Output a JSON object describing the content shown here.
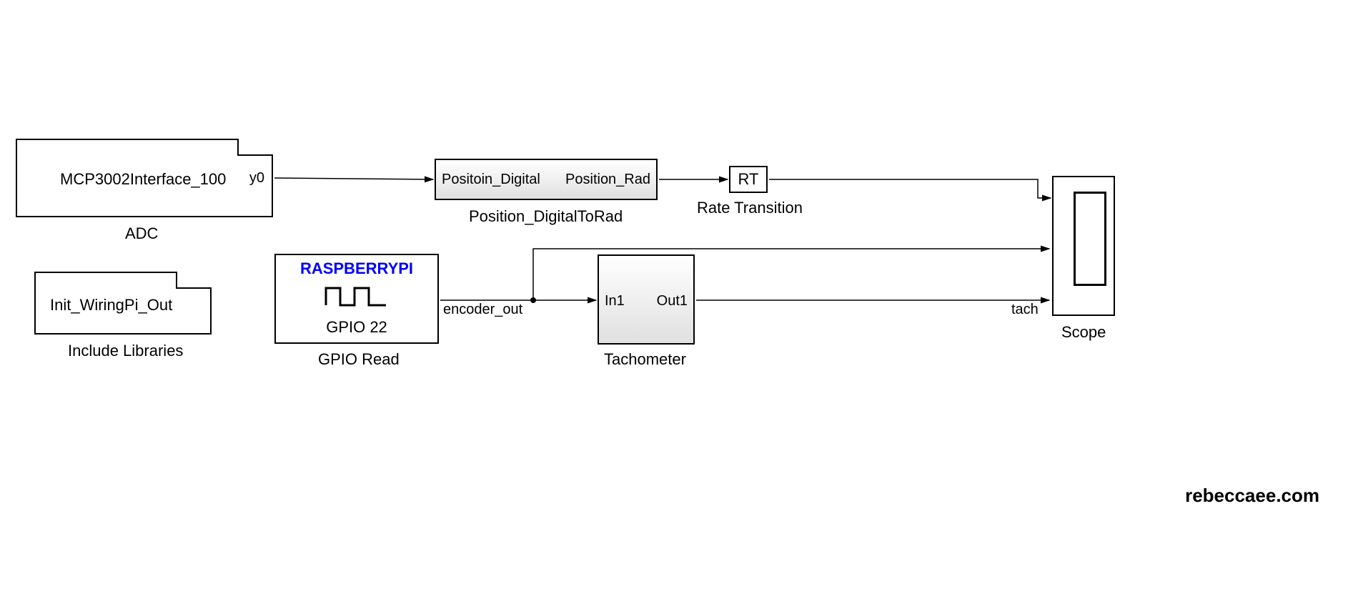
{
  "blocks": {
    "adc": {
      "inner": "MCP3002Interface_100",
      "port_out": "y0",
      "label": "ADC"
    },
    "include": {
      "inner": "Init_WiringPi_Out",
      "label": "Include Libraries"
    },
    "gpio": {
      "top": "RASPBERRYPI",
      "pin": "GPIO 22",
      "label": "GPIO Read"
    },
    "d2r": {
      "port_in": "Positoin_Digital",
      "port_out": "Position_Rad",
      "label": "Position_DigitalToRad"
    },
    "rt": {
      "inner": "RT",
      "label": "Rate Transition"
    },
    "tach": {
      "port_in": "In1",
      "port_out": "Out1",
      "label": "Tachometer"
    },
    "scope": {
      "label": "Scope"
    }
  },
  "signals": {
    "encoder": "encoder_out",
    "tach": "tach"
  },
  "watermark": "rebeccaee.com"
}
